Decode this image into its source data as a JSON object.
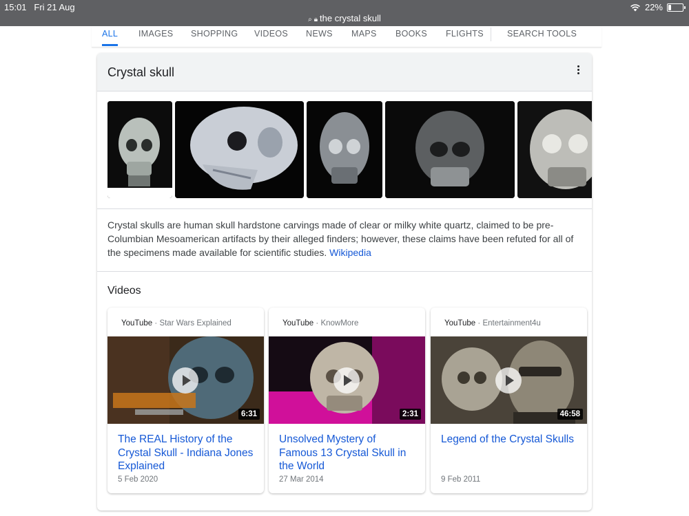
{
  "status": {
    "time": "15:01",
    "date": "Fri 21 Aug",
    "url": "the crystal skull",
    "battery": "22%",
    "battery_level": 0.22
  },
  "tabs": [
    {
      "label": "ALL",
      "active": true
    },
    {
      "label": "IMAGES"
    },
    {
      "label": "SHOPPING"
    },
    {
      "label": "VIDEOS"
    },
    {
      "label": "NEWS"
    },
    {
      "label": "MAPS"
    },
    {
      "label": "BOOKS"
    },
    {
      "label": "FLIGHTS"
    },
    {
      "label": "SEARCH TOOLS"
    }
  ],
  "panel": {
    "title": "Crystal skull",
    "description": "Crystal skulls are human skull hardstone carvings made of clear or milky white quartz, claimed to be pre-Columbian Mesoamerican artifacts by their alleged finders; however, these claims have been refuted for all of the specimens made available for scientific studies.",
    "source_link": "Wikipedia",
    "videos_heading": "Videos"
  },
  "videos": [
    {
      "source": "YouTube",
      "channel": "Star Wars Explained",
      "duration": "6:31",
      "title": "The REAL History of the Crystal Skull - Indiana Jones Explained",
      "date": "5 Feb 2020"
    },
    {
      "source": "YouTube",
      "channel": "KnowMore",
      "duration": "2:31",
      "title": "Unsolved Mystery of Famous 13 Crystal Skull in the World",
      "date": "27 Mar 2014"
    },
    {
      "source": "YouTube",
      "channel": "Entertainment4u",
      "duration": "46:58",
      "title": "Legend of the Crystal Skulls",
      "date": "9 Feb 2011"
    }
  ],
  "colors": {
    "accent": "#1a73e8",
    "link": "#1558d6",
    "status_bar": "#5f6063"
  }
}
